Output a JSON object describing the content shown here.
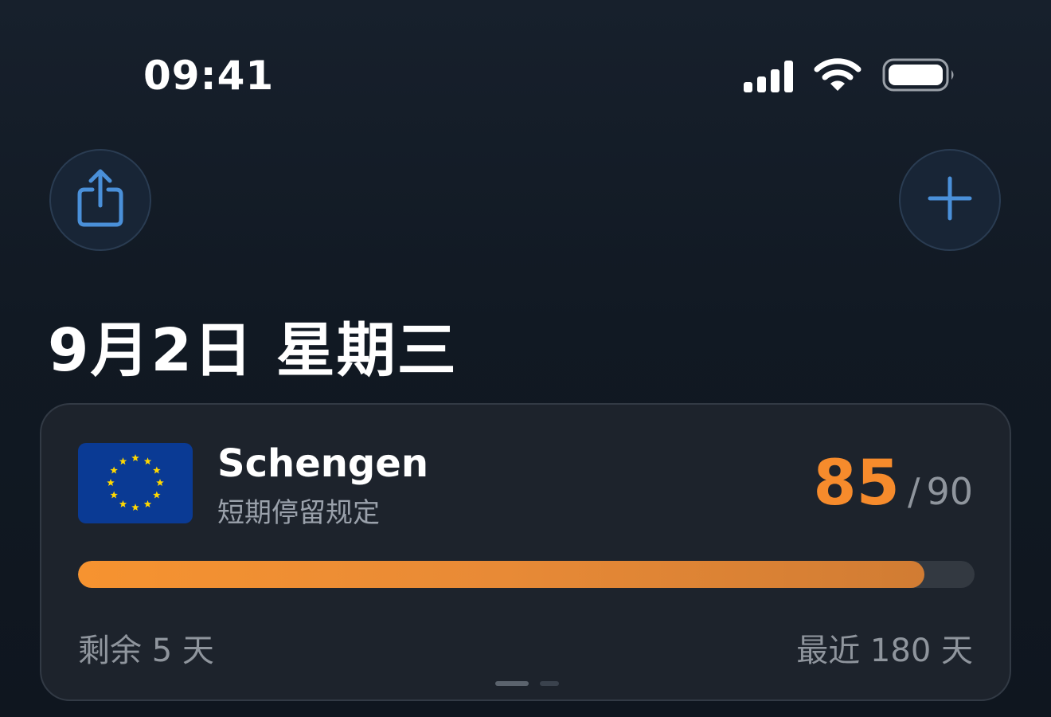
{
  "status_bar": {
    "time": "09:41",
    "icons": [
      "cellular-signal-icon",
      "wifi-icon",
      "battery-icon"
    ]
  },
  "toolbar": {
    "share_icon": "share-icon",
    "add_icon": "plus-icon",
    "accent_color": "#4a90d9"
  },
  "header": {
    "date_title": "9月2日 星期三"
  },
  "card": {
    "flag_icon": "eu-flag-icon",
    "title": "Schengen",
    "subtitle": "短期停留规定",
    "used_days": "85",
    "separator": "/",
    "total_days": "90",
    "progress_fraction": 0.944,
    "remaining_text": "剩余 5 天",
    "period_text": "最近 180 天",
    "accent_color": "#f68b2c",
    "page_indicator": {
      "pages": 2,
      "current": 1
    }
  }
}
